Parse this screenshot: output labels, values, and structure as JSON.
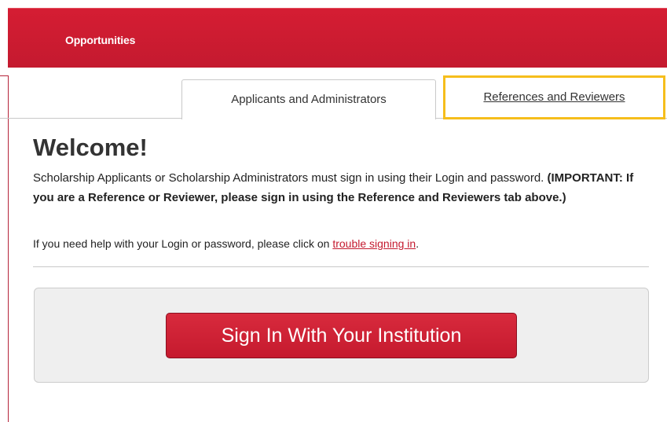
{
  "header": {
    "nav_label": "Opportunities"
  },
  "tabs": [
    {
      "label": "Applicants and Administrators",
      "active": true
    },
    {
      "label": "References and Reviewers",
      "active": false
    }
  ],
  "welcome": {
    "title": "Welcome!",
    "intro_text": "Scholarship Applicants or Scholarship Administrators must sign in using their Login and password.",
    "important_text": "(IMPORTANT: If you are a Reference or Reviewer, please sign in using the Reference and Reviewers tab above.)",
    "help_prefix": "If you need help with your Login or password, please click on",
    "help_link": "trouble signing in",
    "help_suffix": "."
  },
  "signin": {
    "button_label": "Sign In With Your Institution"
  },
  "colors": {
    "brand_red": "#c41a2f",
    "highlight": "#f6be1c",
    "panel_bg": "#efefef"
  }
}
